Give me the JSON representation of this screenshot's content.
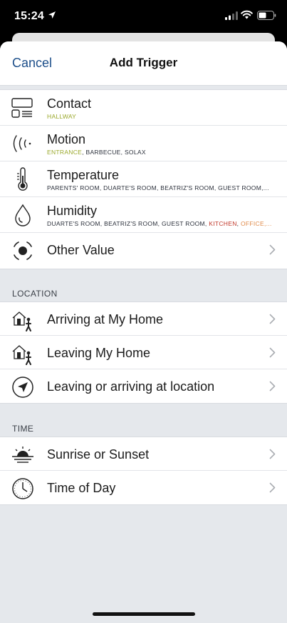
{
  "status": {
    "time": "15:24"
  },
  "nav": {
    "cancel": "Cancel",
    "title": "Add Trigger"
  },
  "sensors": [
    {
      "title": "Contact",
      "icon": "contact-sensor-icon",
      "subtitle": [
        {
          "text": "HALLWAY",
          "color": "#9aa82a"
        }
      ]
    },
    {
      "title": "Motion",
      "icon": "motion-icon",
      "subtitle": [
        {
          "text": "ENTRANCE",
          "color": "#9aa82a"
        },
        {
          "text": ", BARBECUE, SOLAX",
          "color": "#2a2f3a"
        }
      ]
    },
    {
      "title": "Temperature",
      "icon": "thermometer-icon",
      "subtitle": [
        {
          "text": "PARENTS' ROOM, DUARTE'S ROOM, BEATRIZ'S ROOM, GUEST ROOM,...",
          "color": "#2a2f3a"
        }
      ]
    },
    {
      "title": "Humidity",
      "icon": "droplet-icon",
      "subtitle": [
        {
          "text": "DUARTE'S ROOM, BEATRIZ'S ROOM, GUEST ROOM, ",
          "color": "#2a2f3a"
        },
        {
          "text": "KITCHEN",
          "color": "#c0392b"
        },
        {
          "text": ", ",
          "color": "#2a2f3a"
        },
        {
          "text": "OFFICE,...",
          "color": "#e08b4a"
        }
      ]
    },
    {
      "title": "Other Value",
      "icon": "other-value-icon"
    }
  ],
  "location": {
    "label": "LOCATION",
    "items": [
      {
        "title": "Arriving at My Home",
        "icon": "arriving-home-icon"
      },
      {
        "title": "Leaving My Home",
        "icon": "leaving-home-icon"
      },
      {
        "title": "Leaving or arriving at location",
        "icon": "location-arrow-icon"
      }
    ]
  },
  "time": {
    "label": "TIME",
    "items": [
      {
        "title": "Sunrise or Sunset",
        "icon": "sunrise-icon"
      },
      {
        "title": "Time of Day",
        "icon": "clock-icon"
      }
    ]
  }
}
